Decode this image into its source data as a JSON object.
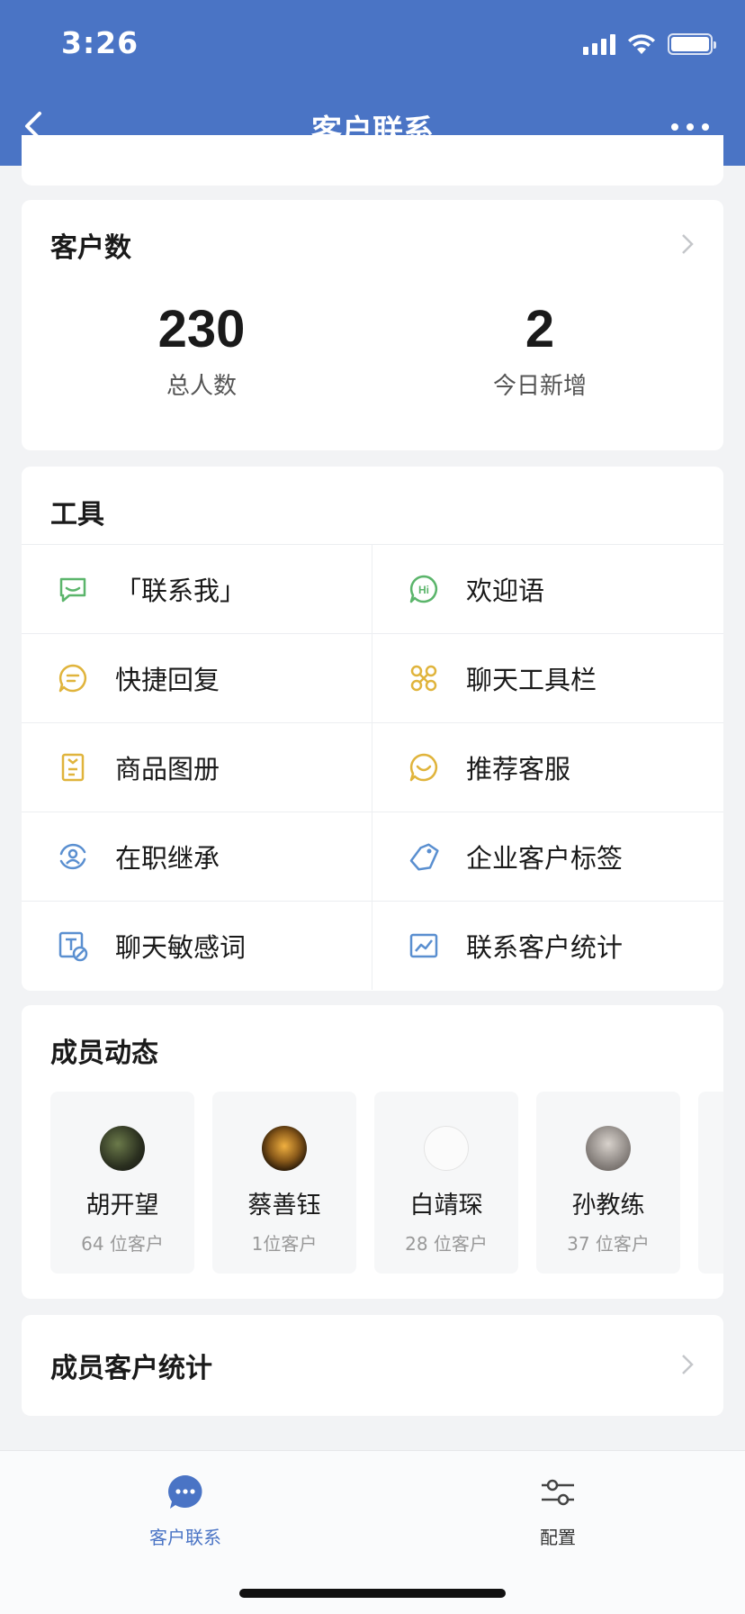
{
  "status_bar": {
    "time": "3:26"
  },
  "nav": {
    "title": "客户联系"
  },
  "stats": {
    "title": "客户数",
    "total_value": "230",
    "total_label": "总人数",
    "today_value": "2",
    "today_label": "今日新增"
  },
  "tools": {
    "title": "工具",
    "items": [
      {
        "label": "「联系我」",
        "icon": "message-square-icon",
        "color": "#5bb56b"
      },
      {
        "label": "欢迎语",
        "icon": "hi-bubble-icon",
        "color": "#5bb56b"
      },
      {
        "label": "快捷回复",
        "icon": "quick-reply-icon",
        "color": "#e0b43c"
      },
      {
        "label": "聊天工具栏",
        "icon": "toolbar-grid-icon",
        "color": "#e0b43c"
      },
      {
        "label": "商品图册",
        "icon": "product-album-icon",
        "color": "#e0b43c"
      },
      {
        "label": "推荐客服",
        "icon": "recommend-service-icon",
        "color": "#e0b43c"
      },
      {
        "label": "在职继承",
        "icon": "inherit-user-icon",
        "color": "#5a8fd0"
      },
      {
        "label": "企业客户标签",
        "icon": "tag-icon",
        "color": "#5a8fd0"
      },
      {
        "label": "聊天敏感词",
        "icon": "sensitive-word-icon",
        "color": "#5a8fd0"
      },
      {
        "label": "联系客户统计",
        "icon": "chart-icon",
        "color": "#5a8fd0"
      }
    ]
  },
  "members": {
    "title": "成员动态",
    "items": [
      {
        "name": "胡开望",
        "count": "64 位客户"
      },
      {
        "name": "蔡善钰",
        "count": "1位客户"
      },
      {
        "name": "白靖琛",
        "count": "28 位客户"
      },
      {
        "name": "孙教练",
        "count": "37 位客户"
      }
    ]
  },
  "member_stats": {
    "title": "成员客户统计"
  },
  "tabbar": {
    "tabs": [
      {
        "label": "客户联系",
        "active": true
      },
      {
        "label": "配置",
        "active": false
      }
    ]
  },
  "colors": {
    "header": "#4a74c5",
    "accent": "#4a74c5"
  }
}
